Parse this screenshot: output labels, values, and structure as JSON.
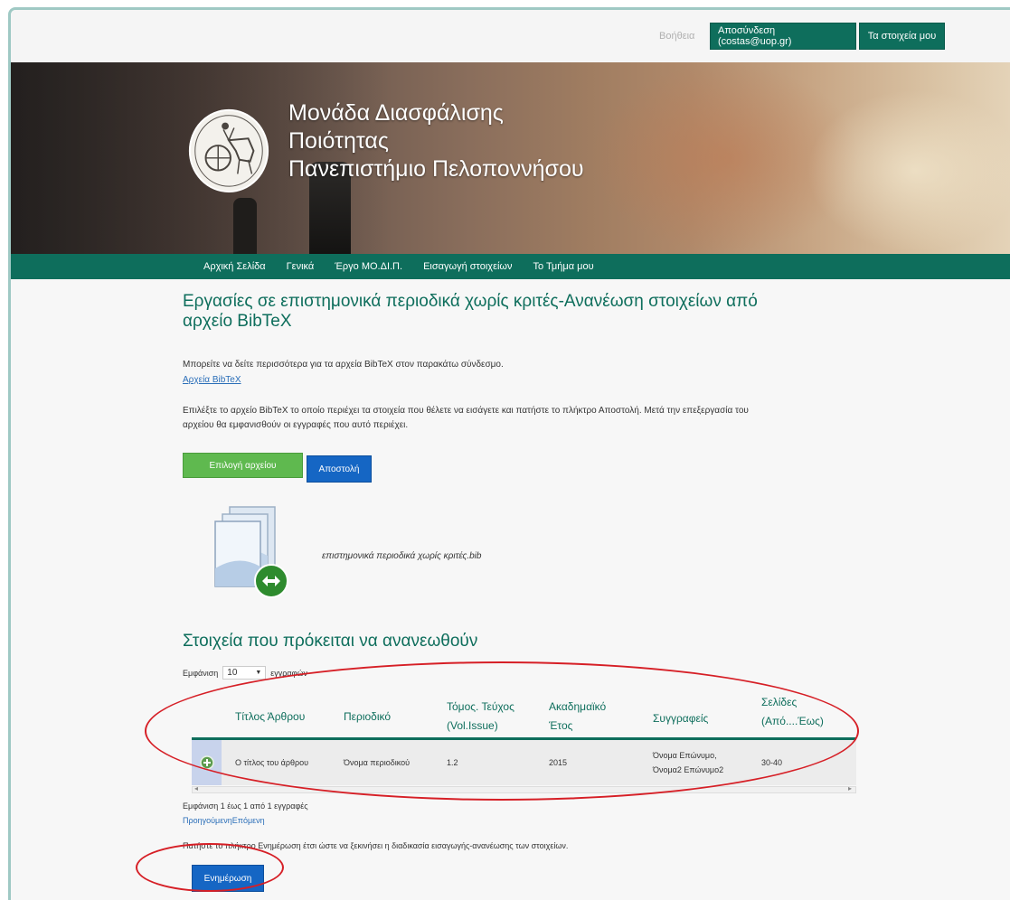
{
  "topbar": {
    "help": "Βοήθεια",
    "logout": "Αποσύνδεση (costas@uop.gr)",
    "my_data": "Τα στοιχεία μου"
  },
  "banner": {
    "title_lines": [
      "Μονάδα Διασφάλισης",
      "Ποιότητας",
      "Πανεπιστήμιο Πελοποννήσου"
    ]
  },
  "nav": {
    "items": [
      "Αρχική Σελίδα",
      "Γενικά",
      "Έργο ΜΟ.ΔΙ.Π.",
      "Εισαγωγή στοιχείων",
      "Το Τμήμα μου"
    ]
  },
  "page": {
    "title": "Εργασίες σε επιστημονικά περιοδικά χωρίς κριτές-Ανανέωση στοιχείων από αρχείο BibTeX",
    "info_text": "Μπορείτε να δείτε περισσότερα για τα αρχεία BibTeX στον παρακάτω σύνδεσμο.",
    "info_link": "Αρχεία BibTeX",
    "instructions": "Επιλέξτε το αρχείο BibTeX το οποίο περιέχει τα στοιχεία που θέλετε να εισάγετε και πατήστε το πλήκτρο Αποστολή. Μετά την επεξεργασία του αρχείου θα εμφανισθούν οι εγγραφές που αυτό περιέχει.",
    "choose_file_button": "Επιλογή αρχείου",
    "send_button": "Αποστολή",
    "file_name": "επιστημονικά περιοδικά χωρίς κριτές.bib",
    "section_title": "Στοιχεία που πρόκειται να ανανεωθούν",
    "show_prefix": "Εμφάνιση",
    "show_value": "10",
    "show_suffix": "εγγραφών"
  },
  "table": {
    "headers": [
      {
        "line1": "Τίτλος Άρθρου",
        "line2": ""
      },
      {
        "line1": "Περιοδικό",
        "line2": ""
      },
      {
        "line1": "Τόμος. Τεύχος",
        "line2": "(Vol.Issue)"
      },
      {
        "line1": "Ακαδημαϊκό",
        "line2": "Έτος"
      },
      {
        "line1": "Συγγραφείς",
        "line2": ""
      },
      {
        "line1": "Σελίδες",
        "line2": "(Από....Έως)"
      }
    ],
    "rows": [
      {
        "title": "Ο τίτλος του άρθρου",
        "journal": "Όνομα περιοδικού",
        "volume": "1.2",
        "year": "2015",
        "authors_1": "Όνομα Επώνυμο,",
        "authors_2": "Όνομα2 Επώνυμο2",
        "pages": "30-40"
      }
    ]
  },
  "footer": {
    "info": "Εμφάνιση 1 έως 1 από 1 εγγραφές",
    "pager": "ΠροηγούμενηΕπόμενη",
    "update_note": "Πατήστε το πλήκτρο Ενημέρωση έτσι ώστε να ξεκινήσει η διαδικασία εισαγωγής-ανανέωσης των στοιχείων.",
    "update_button": "Ενημέρωση"
  },
  "colors": {
    "brand_green": "#0e6e5c",
    "file_button": "#5fb94f",
    "primary_blue": "#1566c4",
    "annotation_red": "#d61f26"
  },
  "icons": [
    "seal-logo-icon",
    "file-transfer-icon",
    "expand-row-icon",
    "chevron-down-icon"
  ]
}
